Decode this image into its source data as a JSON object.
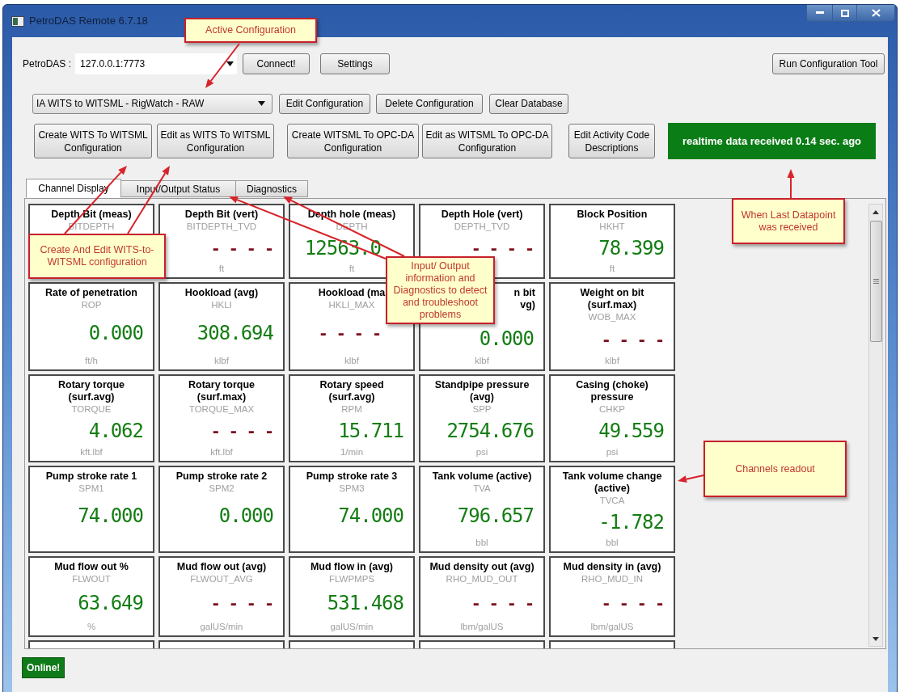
{
  "window": {
    "title": "PetroDAS Remote 6.7.18"
  },
  "connection": {
    "label": "PetroDAS :",
    "address": "127.0.0.1:7773",
    "buttons": [
      "Connect!",
      "Settings"
    ]
  },
  "run_tool_button": "Run Configuration Tool",
  "configuration": {
    "selected": "IA WITS to WITSML - RigWatch - RAW",
    "buttons": [
      "Edit Configuration",
      "Delete Configuration",
      "Clear Database"
    ]
  },
  "actions": [
    {
      "lines": [
        "Create WITS To WITSML",
        "Configuration"
      ]
    },
    {
      "lines": [
        "Edit as WITS To WITSML",
        "Configuration"
      ]
    },
    {
      "lines": [
        "Create WITSML To OPC-DA",
        "Configuration"
      ]
    },
    {
      "lines": [
        "Edit as WITSML To OPC-DA",
        "Configuration"
      ]
    },
    {
      "lines": [
        "Edit Activity Code",
        "Descriptions"
      ]
    }
  ],
  "realtime_banner": "realtime data received 0.14 sec. ago",
  "tabs": [
    {
      "label": "Channel Display",
      "selected": true
    },
    {
      "label": "Input/Output Status",
      "selected": false
    },
    {
      "label": "Diagnostics",
      "selected": false
    }
  ],
  "channels": [
    {
      "kind": "full",
      "title": [
        "Depth Bit (meas)"
      ],
      "mnemonic": "BITDEPTH"
    },
    {
      "kind": "full",
      "title": [
        "Depth Bit (vert)"
      ],
      "mnemonic": "BITDEPTH_TVD",
      "value": "- - - -",
      "has_data": false,
      "unit": "ft"
    },
    {
      "kind": "covered_right",
      "title": [
        "Depth hole (meas)"
      ],
      "mnemonic": "DEPTH",
      "value": "12563.0",
      "has_data": true,
      "unit": "ft"
    },
    {
      "kind": "full",
      "title": [
        "Depth Hole (vert)"
      ],
      "mnemonic": "DEPTH_TVD",
      "value": "- - - -",
      "has_data": false
    },
    {
      "kind": "full",
      "title": [
        "Block Position"
      ],
      "mnemonic": "HKHT",
      "value": "78.399",
      "has_data": true,
      "unit": "ft"
    },
    {
      "kind": "full",
      "title": [
        "Rate of penetration"
      ],
      "mnemonic": "ROP",
      "value": "0.000",
      "has_data": true,
      "unit": "ft/h"
    },
    {
      "kind": "full",
      "title": [
        "Hookload (avg)"
      ],
      "mnemonic": "HKLI",
      "value": "308.694",
      "has_data": true,
      "unit": "klbf"
    },
    {
      "kind": "covered_right",
      "title": [
        "Hookload (ma"
      ],
      "mnemonic": "HKLI_MAX",
      "value": "- - - -",
      "has_data": false,
      "unit": "klbf"
    },
    {
      "kind": "covered_left",
      "title": [
        "n bit",
        "vg)"
      ],
      "value": "0.000",
      "has_data": true,
      "unit": "klbf"
    },
    {
      "kind": "full",
      "title": [
        "Weight on bit",
        "(surf.max)"
      ],
      "mnemonic": "WOB_MAX",
      "value": "- - - -",
      "has_data": false,
      "unit": "klbf"
    },
    {
      "kind": "full",
      "title": [
        "Rotary torque",
        "(surf.avg)"
      ],
      "mnemonic": "TORQUE",
      "value": "4.062",
      "has_data": true,
      "unit": "kft.lbf"
    },
    {
      "kind": "full",
      "title": [
        "Rotary torque",
        "(surf.max)"
      ],
      "mnemonic": "TORQUE_MAX",
      "value": "- - - -",
      "has_data": false,
      "unit": "kft.lbf"
    },
    {
      "kind": "full",
      "title": [
        "Rotary speed",
        "(surf.avg)"
      ],
      "mnemonic": "RPM",
      "value": "15.711",
      "has_data": true,
      "unit": "1/min"
    },
    {
      "kind": "full",
      "title": [
        "Standpipe pressure",
        "(avg)"
      ],
      "mnemonic": "SPP",
      "value": "2754.676",
      "has_data": true,
      "unit": "psi"
    },
    {
      "kind": "full",
      "title": [
        "Casing (choke)",
        "pressure"
      ],
      "mnemonic": "CHKP",
      "value": "49.559",
      "has_data": true,
      "unit": "psi"
    },
    {
      "kind": "full",
      "title": [
        "Pump stroke rate 1"
      ],
      "mnemonic": "SPM1",
      "value": "74.000",
      "has_data": true
    },
    {
      "kind": "full",
      "title": [
        "Pump stroke rate 2"
      ],
      "mnemonic": "SPM2",
      "value": "0.000",
      "has_data": true
    },
    {
      "kind": "full",
      "title": [
        "Pump stroke rate 3"
      ],
      "mnemonic": "SPM3",
      "value": "74.000",
      "has_data": true
    },
    {
      "kind": "full",
      "title": [
        "Tank volume (active)"
      ],
      "mnemonic": "TVA",
      "value": "796.657",
      "has_data": true,
      "unit": "bbl"
    },
    {
      "kind": "full",
      "title": [
        "Tank volume change",
        "(active)"
      ],
      "mnemonic": "TVCA",
      "value": "-1.782",
      "has_data": true,
      "unit": "bbl"
    },
    {
      "kind": "full",
      "title": [
        "Mud flow out %"
      ],
      "mnemonic": "FLWOUT",
      "value": "63.649",
      "has_data": true,
      "unit": "%"
    },
    {
      "kind": "full",
      "title": [
        "Mud flow out (avg)"
      ],
      "mnemonic": "FLWOUT_AVG",
      "value": "- - - -",
      "has_data": false,
      "unit": "galUS/min"
    },
    {
      "kind": "full",
      "title": [
        "Mud flow in (avg)"
      ],
      "mnemonic": "FLWPMPS",
      "value": "531.468",
      "has_data": true,
      "unit": "galUS/min"
    },
    {
      "kind": "full",
      "title": [
        "Mud density out (avg)"
      ],
      "mnemonic": "RHO_MUD_OUT",
      "value": "- - - -",
      "has_data": false,
      "unit": "lbm/galUS"
    },
    {
      "kind": "full",
      "title": [
        "Mud density in (avg)"
      ],
      "mnemonic": "RHO_MUD_IN",
      "value": "- - - -",
      "has_data": false,
      "unit": "lbm/galUS"
    },
    {
      "kind": "cut"
    },
    {
      "kind": "cut"
    },
    {
      "kind": "cut"
    },
    {
      "kind": "cut"
    },
    {
      "kind": "cut"
    }
  ],
  "status_badge": "Online!",
  "callouts": [
    {
      "text": "Active Configuration"
    },
    {
      "text": "Create And Edit WITS-to-WITSML configuration"
    },
    {
      "text": "Input/ Output information and Diagnostics to detect and troubleshoot problems"
    },
    {
      "text": "When Last Datapoint was received"
    },
    {
      "text": "Channels readout"
    }
  ]
}
